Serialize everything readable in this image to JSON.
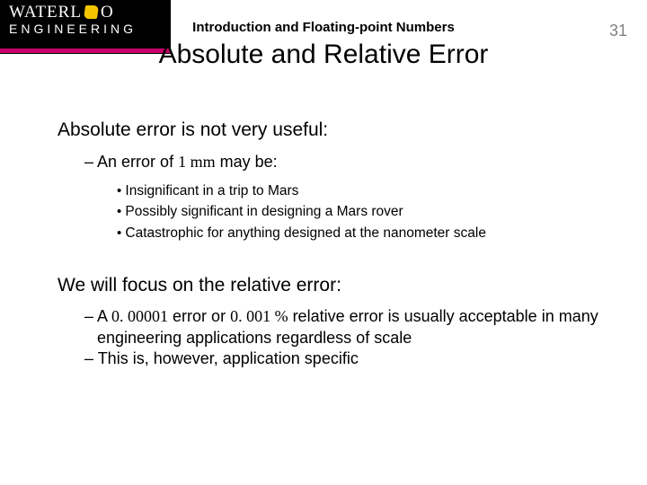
{
  "logo": {
    "wordmark_a": "WATERL",
    "wordmark_b": "O",
    "subline": "ENGINEERING"
  },
  "header": {
    "subtitle": "Introduction and Floating-point Numbers",
    "pagenum": "31"
  },
  "title": "Absolute and Relative Error",
  "body": {
    "para1": "Absolute error is not very useful:",
    "dash1_a": "An error of ",
    "dash1_mm": "1 mm",
    "dash1_b": " may be:",
    "bul1": "Insignificant in a trip to Mars",
    "bul2": "Possibly significant in designing a Mars rover",
    "bul3": "Catastrophic for anything designed at the nanometer scale",
    "para2": "We will focus on the relative error:",
    "dash2_a": "A ",
    "dash2_v1": "0. 00001",
    "dash2_mid": " error or ",
    "dash2_v2": "0. 001 %",
    "dash2_b": " relative error is usually acceptable in many engineering applications regardless of scale",
    "dash3": "This is, however, application specific"
  }
}
